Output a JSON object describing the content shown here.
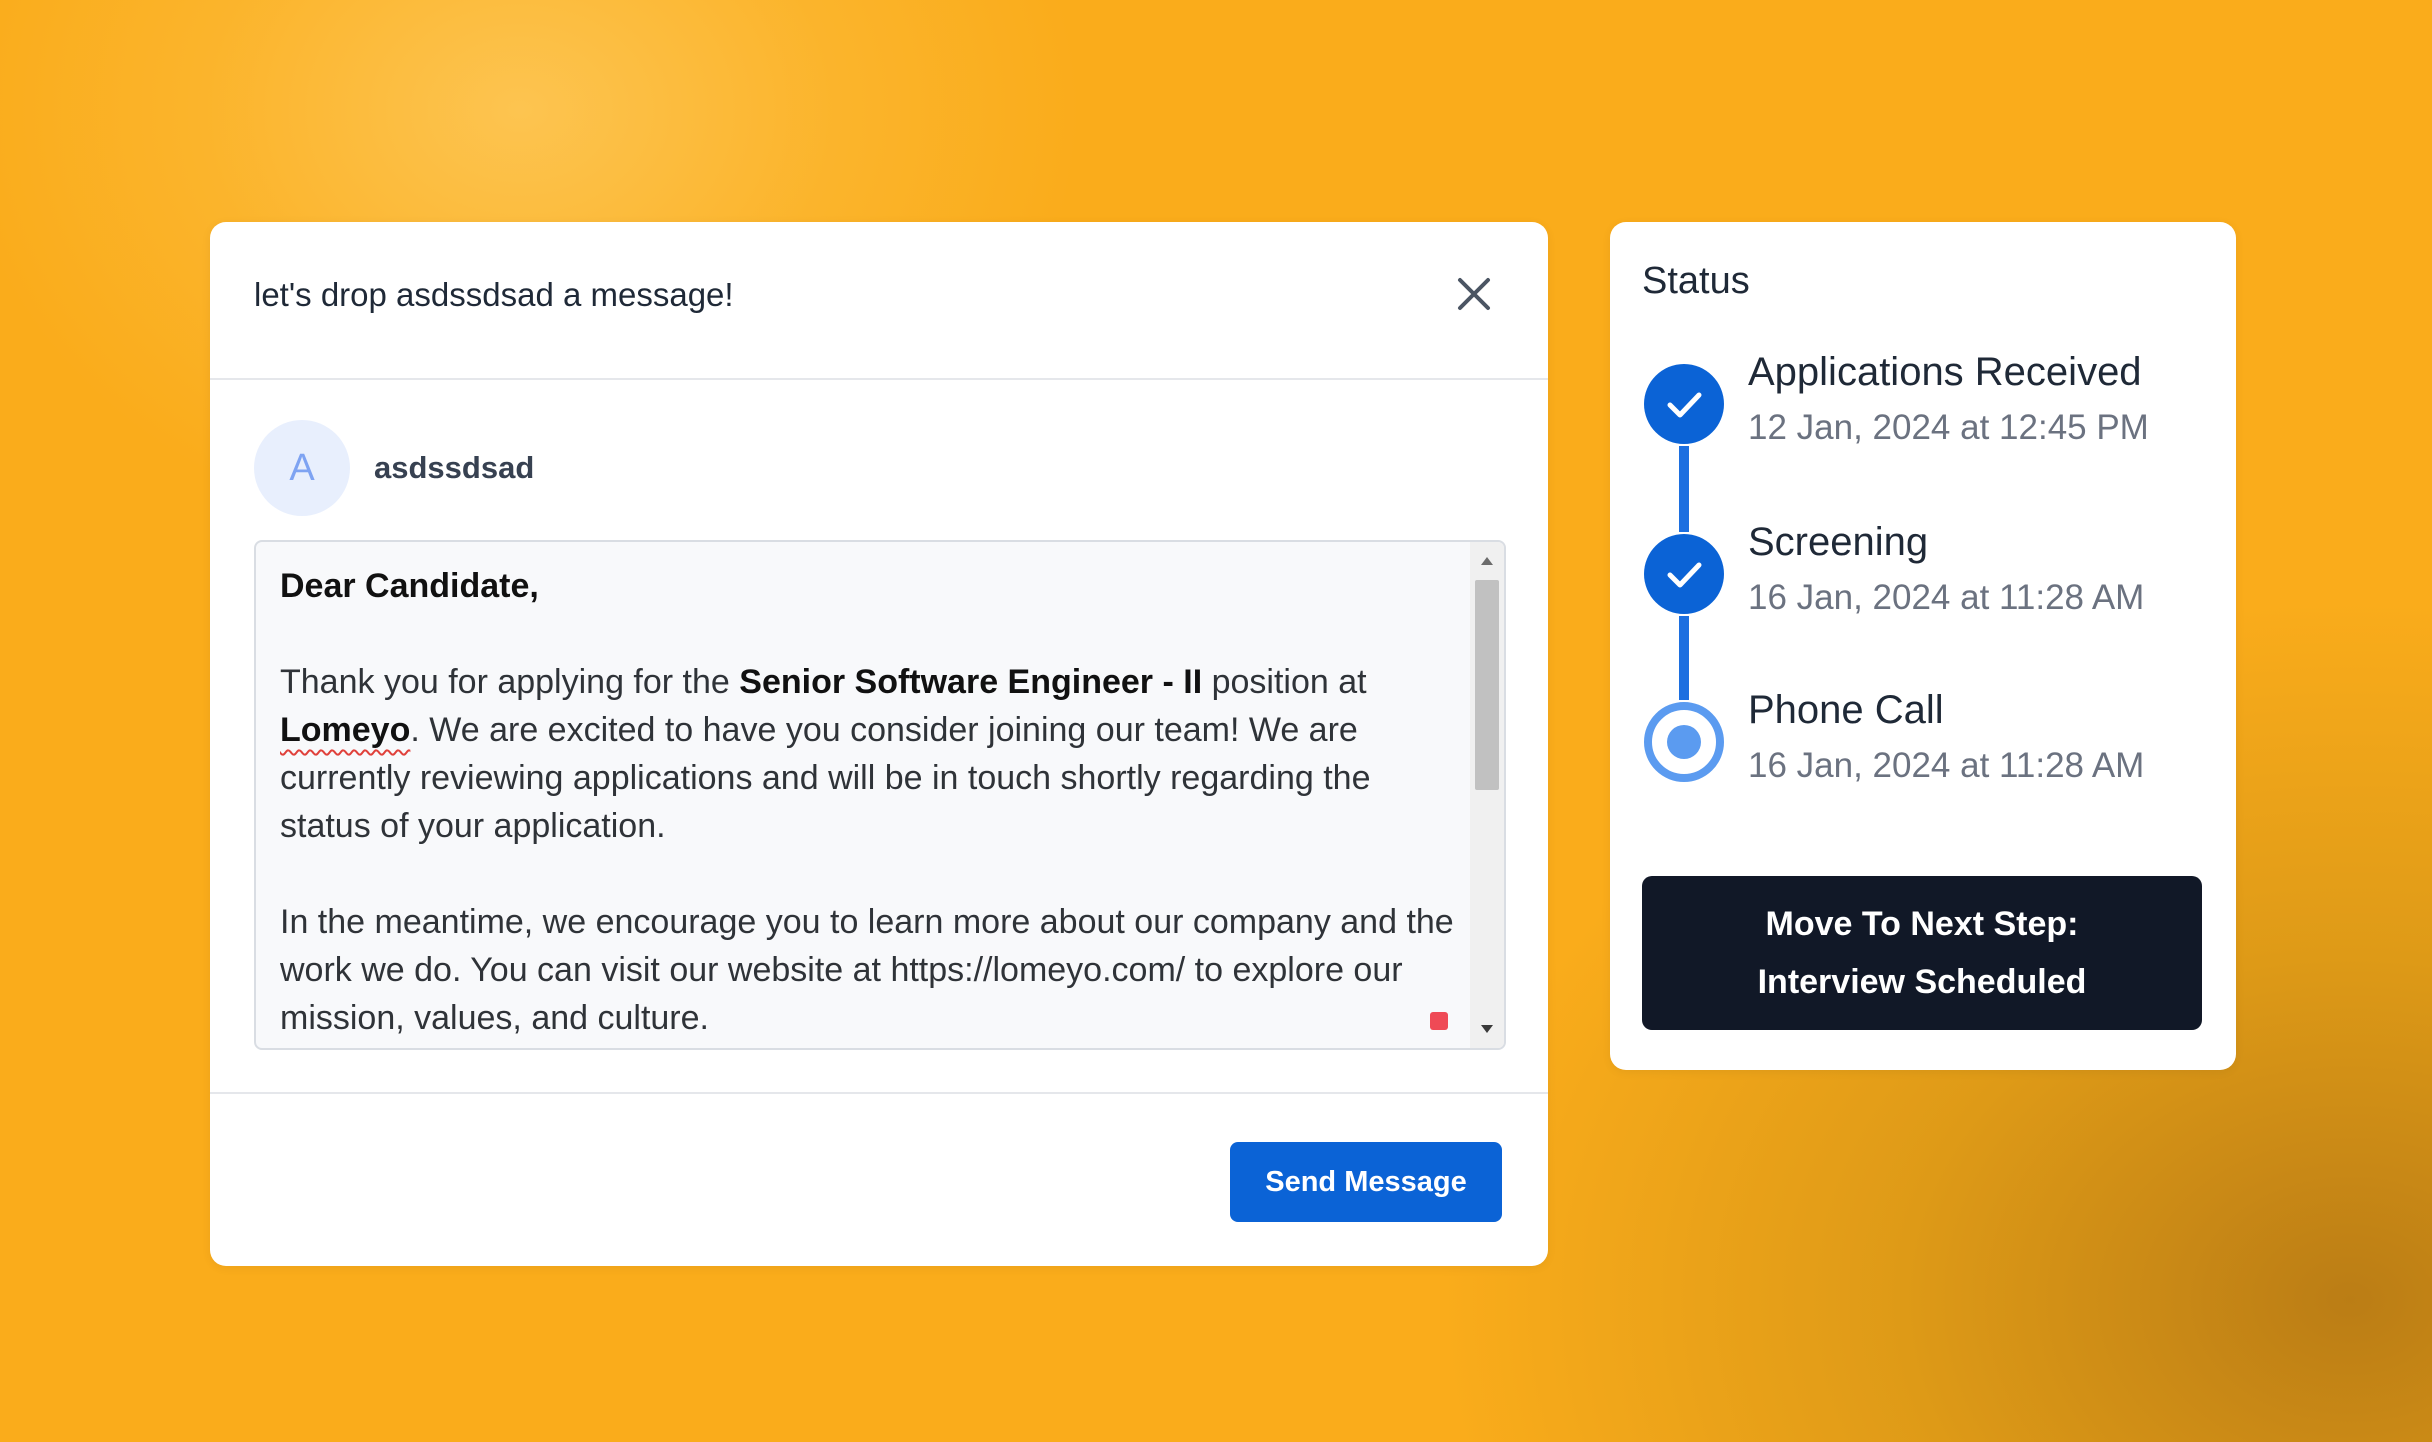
{
  "dialog": {
    "title": "let's drop asdssdsad a message!",
    "close_icon": "close-icon",
    "recipient": {
      "avatar_initial": "A",
      "name": "asdssdsad"
    },
    "message": {
      "greeting": "Dear Candidate,",
      "p1_before": "Thank you for applying for the ",
      "p1_role": "Senior Software Engineer - II",
      "p1_mid": " position at ",
      "p1_company": "Lomeyo",
      "p1_after": ". We are excited to have you consider joining our team! We are currently reviewing applications and will be in touch shortly regarding the status of your application.",
      "p2": "In the meantime, we encourage you to learn more about our company and the work we do. You can visit our website at https://lomeyo.com/ to explore our mission, values, and culture."
    },
    "send_label": "Send Message"
  },
  "status": {
    "title": "Status",
    "steps": [
      {
        "label": "Applications Received",
        "date": "12 Jan, 2024 at 12:45 PM",
        "state": "done"
      },
      {
        "label": "Screening",
        "date": "16 Jan, 2024 at 11:28 AM",
        "state": "done"
      },
      {
        "label": "Phone Call",
        "date": "16 Jan, 2024 at 11:28 AM",
        "state": "current"
      }
    ],
    "next_step_line1": "Move To Next Step:",
    "next_step_line2": "Interview Scheduled"
  },
  "colors": {
    "accent": "#0b63d6",
    "timeline": "#1c6fe0",
    "dark_button": "#111827",
    "background": "#faac1b"
  }
}
